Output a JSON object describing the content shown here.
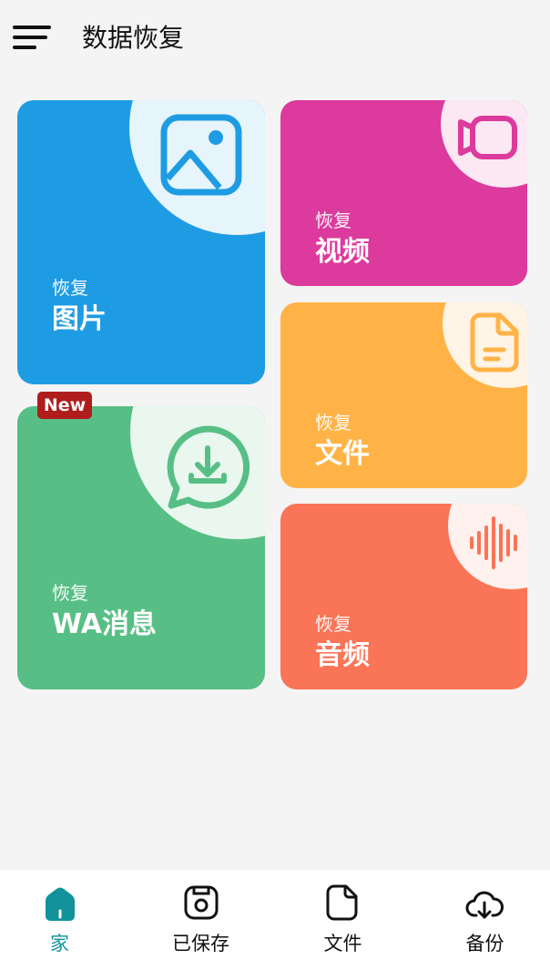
{
  "header": {
    "title": "数据恢复",
    "menu_icon": "hamburger-menu-icon"
  },
  "cards": {
    "images": {
      "sub": "恢复",
      "title": "图片",
      "color": "#1e9ce3",
      "icon": "image-icon"
    },
    "video": {
      "sub": "恢复",
      "title": "视频",
      "color": "#dc3a9c",
      "icon": "video-camera-icon"
    },
    "files": {
      "sub": "恢复",
      "title": "文件",
      "color": "#ffb347",
      "icon": "document-icon"
    },
    "wa": {
      "sub": "恢复",
      "title": "WA消息",
      "color": "#57bf85",
      "icon": "whatsapp-download-icon",
      "badge": "New",
      "badge_color": "#b01d1d"
    },
    "audio": {
      "sub": "恢复",
      "title": "音频",
      "color": "#fa7457",
      "icon": "audio-waveform-icon"
    }
  },
  "bottom_nav": {
    "active": "home",
    "items": [
      {
        "label": "家",
        "icon": "home-icon"
      },
      {
        "label": "已保存",
        "icon": "saved-icon"
      },
      {
        "label": "文件",
        "icon": "file-icon"
      },
      {
        "label": "备份",
        "icon": "cloud-download-icon"
      }
    ],
    "active_color": "#12929b"
  }
}
